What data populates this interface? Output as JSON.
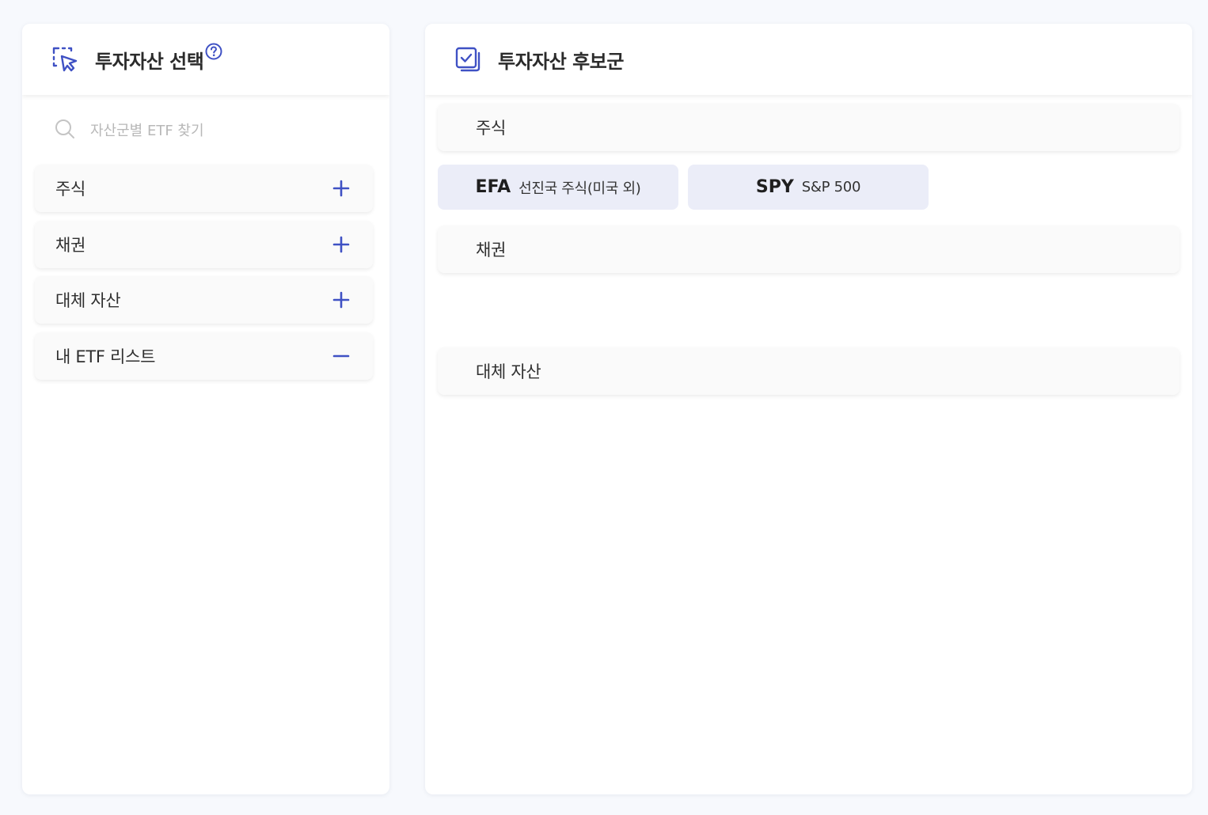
{
  "left_panel": {
    "title": "투자자산 선택",
    "search_placeholder": "자산군별 ETF 찾기",
    "categories": [
      {
        "label": "주식",
        "toggle": "plus"
      },
      {
        "label": "채권",
        "toggle": "plus"
      },
      {
        "label": "대체 자산",
        "toggle": "plus"
      },
      {
        "label": "내 ETF 리스트",
        "toggle": "minus"
      }
    ]
  },
  "right_panel": {
    "title": "투자자산 후보군",
    "groups": [
      {
        "label": "주식",
        "items": [
          {
            "ticker": "EFA",
            "name": "선진국 주식(미국 외)"
          },
          {
            "ticker": "SPY",
            "name": "S&P 500"
          }
        ]
      },
      {
        "label": "채권",
        "items": []
      },
      {
        "label": "대체 자산",
        "items": []
      }
    ]
  },
  "colors": {
    "accent": "#3f51c4",
    "chip_bg": "#ebedf8",
    "background": "#f7f9fd"
  },
  "icons": {
    "left_header": "pointer-selection-icon",
    "help": "question-circle-icon",
    "search": "search-icon",
    "right_header": "checkbox-stack-icon"
  }
}
